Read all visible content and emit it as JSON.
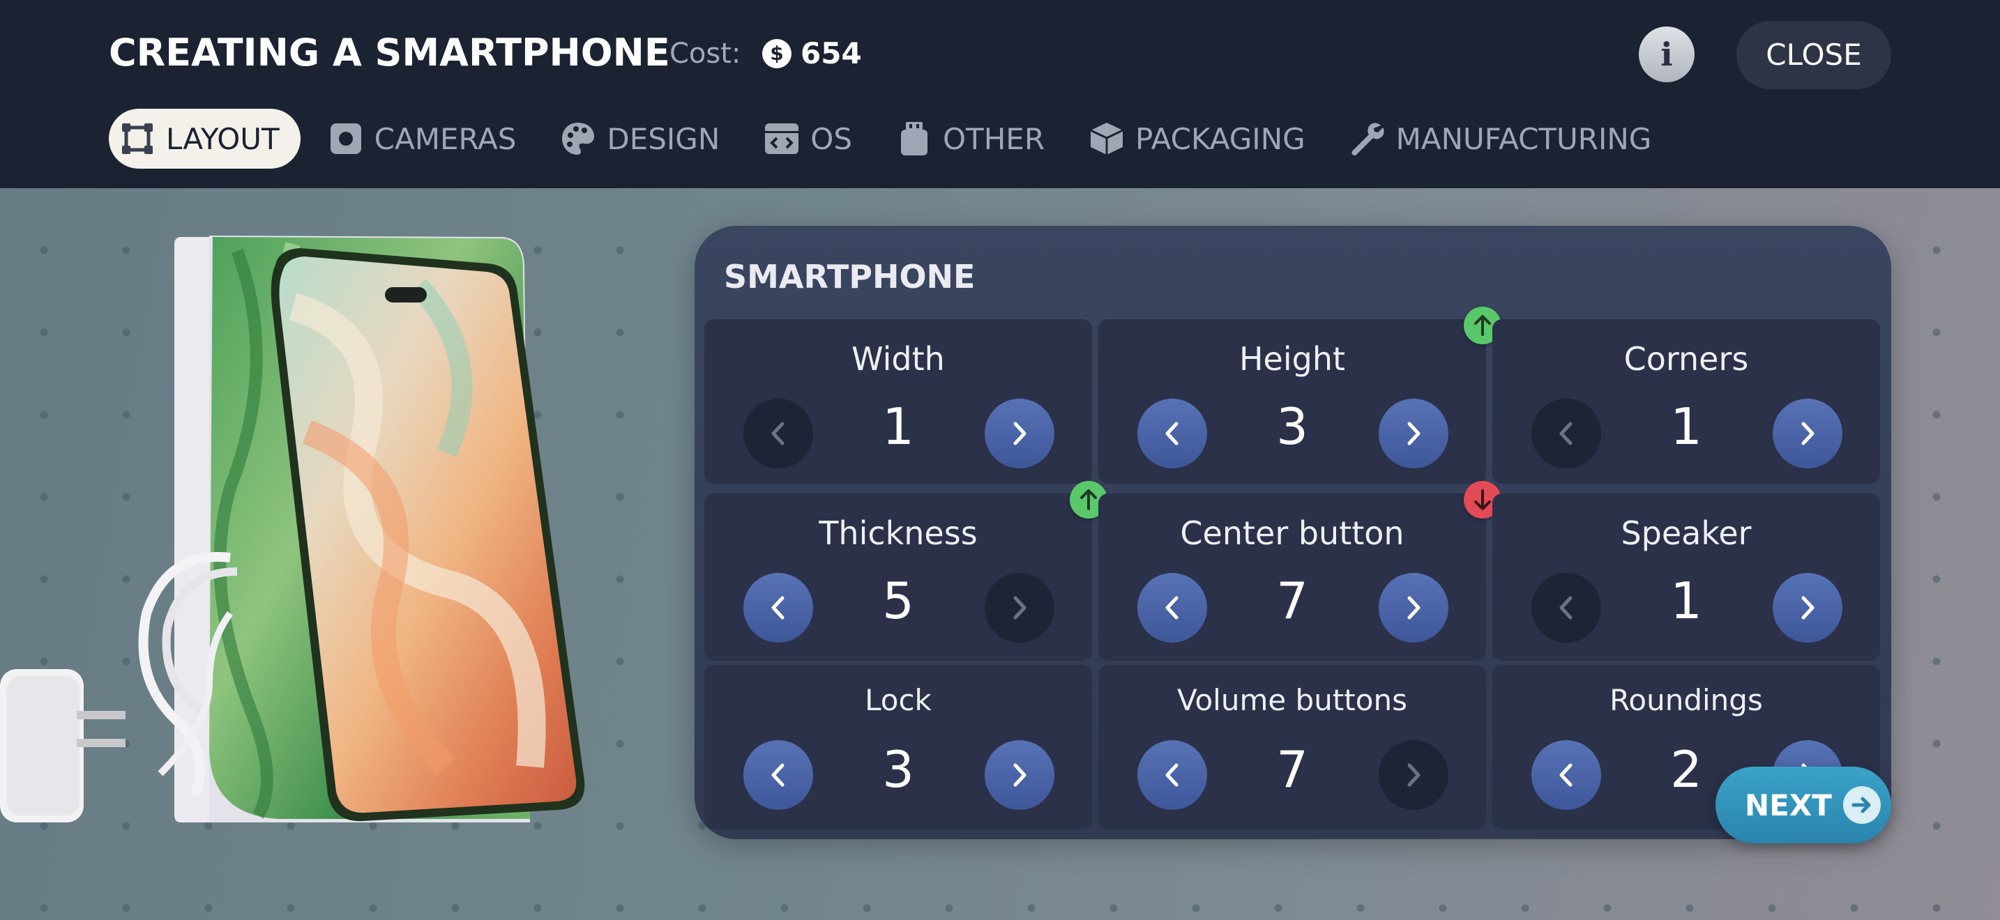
{
  "header": {
    "title": "CREATING A SMARTPHONE",
    "cost_label": "Cost:",
    "cost_value": "654",
    "coin_symbol": "$",
    "info_label": "i",
    "close_label": "CLOSE"
  },
  "tabs": [
    {
      "label": "LAYOUT",
      "icon": "layout-icon",
      "active": true
    },
    {
      "label": "CAMERAS",
      "icon": "camera-icon",
      "active": false
    },
    {
      "label": "DESIGN",
      "icon": "palette-icon",
      "active": false
    },
    {
      "label": "OS",
      "icon": "code-window-icon",
      "active": false
    },
    {
      "label": "OTHER",
      "icon": "chip-icon",
      "active": false
    },
    {
      "label": "PACKAGING",
      "icon": "box-icon",
      "active": false
    },
    {
      "label": "MANUFACTURING",
      "icon": "wrench-icon",
      "active": false
    }
  ],
  "panel": {
    "title": "SMARTPHONE",
    "cells": [
      {
        "label": "Width",
        "value": "1",
        "prev_enabled": false,
        "next_enabled": true,
        "badge": null
      },
      {
        "label": "Height",
        "value": "3",
        "prev_enabled": true,
        "next_enabled": true,
        "badge": "up"
      },
      {
        "label": "Corners",
        "value": "1",
        "prev_enabled": false,
        "next_enabled": true,
        "badge": null
      },
      {
        "label": "Thickness",
        "value": "5",
        "prev_enabled": true,
        "next_enabled": false,
        "badge": "up"
      },
      {
        "label": "Center button",
        "value": "7",
        "prev_enabled": true,
        "next_enabled": true,
        "badge": "down"
      },
      {
        "label": "Speaker",
        "value": "1",
        "prev_enabled": false,
        "next_enabled": true,
        "badge": null
      },
      {
        "label": "Lock",
        "value": "3",
        "prev_enabled": true,
        "next_enabled": true,
        "badge": null
      },
      {
        "label": "Volume buttons",
        "value": "7",
        "prev_enabled": true,
        "next_enabled": false,
        "badge": null
      },
      {
        "label": "Roundings",
        "value": "2",
        "prev_enabled": true,
        "next_enabled": true,
        "badge": null
      }
    ]
  },
  "next_label": "NEXT",
  "colors": {
    "topbar": "#1b2232",
    "panel": "#343e58",
    "accent_button": "#4a64a8",
    "badge_up": "#59c86b",
    "badge_down": "#e24a55",
    "next_button": "#3399c0"
  }
}
